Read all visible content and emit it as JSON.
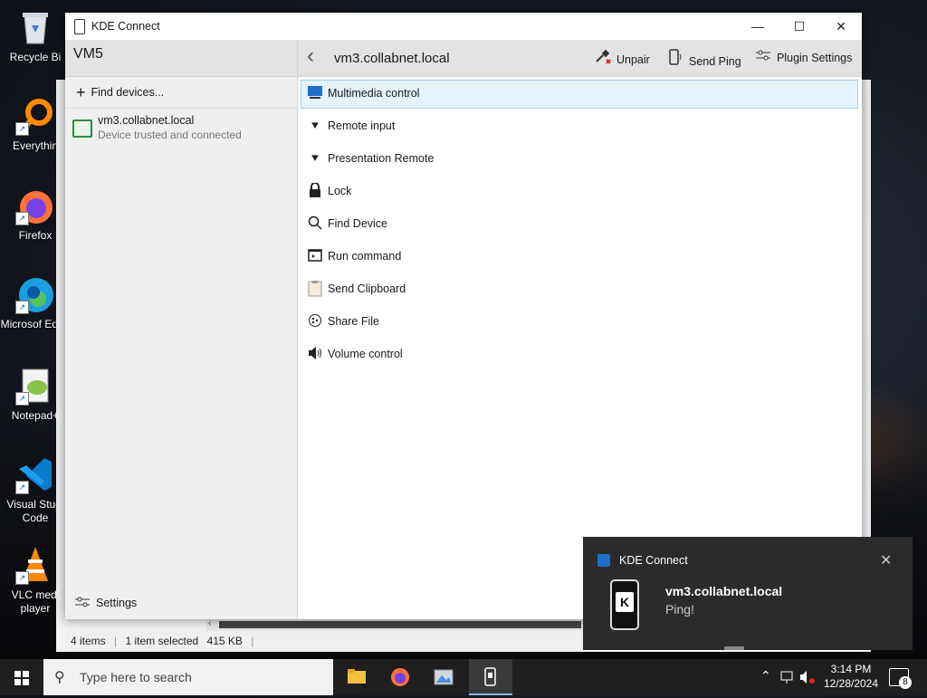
{
  "desktop": {
    "icons": [
      {
        "label": "Recycle Bi",
        "icon": "recycle-bin-icon"
      },
      {
        "label": "Everythin",
        "icon": "everything-search-icon"
      },
      {
        "label": "Firefox",
        "icon": "firefox-icon"
      },
      {
        "label": "Microsof Edge",
        "icon": "edge-icon"
      },
      {
        "label": "Notepad+",
        "icon": "notepad-plus-icon"
      },
      {
        "label": "Visual Studi Code",
        "icon": "vscode-icon"
      },
      {
        "label": "VLC medi player",
        "icon": "vlc-icon"
      }
    ]
  },
  "background_window": {
    "status": {
      "items": "4 items",
      "selected": "1 item selected",
      "size": "415 KB"
    }
  },
  "window": {
    "title": "KDE Connect",
    "controls": {
      "minimize": "—",
      "maximize": "☐",
      "close": "✕"
    }
  },
  "left_pane": {
    "header": "VM5",
    "find_devices": "Find devices...",
    "devices": [
      {
        "name": "vm3.collabnet.local",
        "status": "Device trusted and connected"
      }
    ],
    "settings": "Settings"
  },
  "right_pane": {
    "device_title": "vm3.collabnet.local",
    "toolbar": {
      "unpair": "Unpair",
      "send_ping": "Send Ping",
      "plugin_settings": "Plugin Settings"
    },
    "plugins": [
      {
        "label": "Multimedia control",
        "icon": "multimedia-icon",
        "selected": true
      },
      {
        "label": "Remote input",
        "icon": "pointer-icon"
      },
      {
        "label": "Presentation Remote",
        "icon": "presentation-pointer-icon"
      },
      {
        "label": "Lock",
        "icon": "lock-icon"
      },
      {
        "label": "Find Device",
        "icon": "magnifier-icon"
      },
      {
        "label": "Run command",
        "icon": "terminal-icon"
      },
      {
        "label": "Send Clipboard",
        "icon": "clipboard-icon"
      },
      {
        "label": "Share File",
        "icon": "share-icon"
      },
      {
        "label": "Volume control",
        "icon": "speaker-icon"
      }
    ]
  },
  "notification": {
    "app": "KDE Connect",
    "title": "vm3.collabnet.local",
    "message": "Ping!"
  },
  "taskbar": {
    "search_placeholder": "Type here to search",
    "time": "3:14 PM",
    "date": "12/28/2024",
    "notification_count": "8",
    "pinned": [
      "file-explorer-icon",
      "firefox-icon",
      "photos-icon",
      "kde-connect-icon"
    ]
  }
}
